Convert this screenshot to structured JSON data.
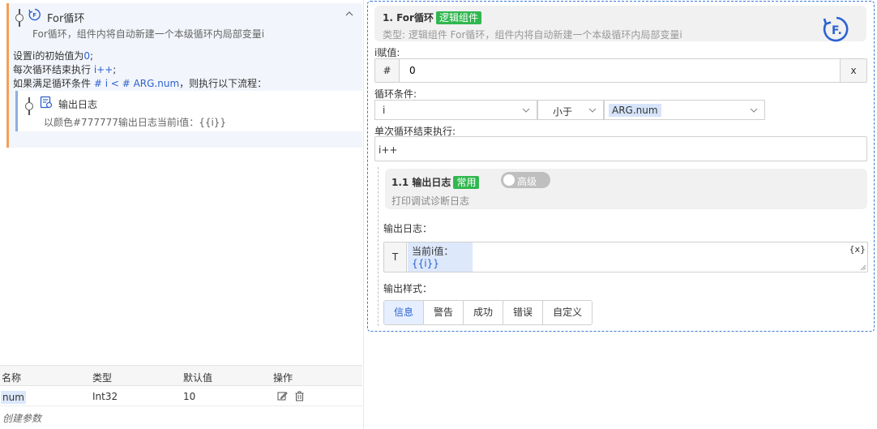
{
  "left": {
    "for_block": {
      "title": "For循环",
      "description": "For循环，组件内将自动新建一个本级循环内局部变量i",
      "body": {
        "line1_prefix": "设置i的初始值为",
        "line1_value": "0",
        "line1_suffix": ";",
        "line2_prefix": "每次循环结束执行 ",
        "line2_value": "i++",
        "line2_suffix": ";",
        "line3_prefix": "如果满足循环条件 ",
        "line3_value": "# i < # ARG.num",
        "line3_suffix": "，则执行以下流程："
      },
      "child": {
        "title": "输出日志",
        "description": "以颜色#777777输出日志当前i值：{{i}}"
      }
    },
    "params_table": {
      "headers": [
        "名称",
        "类型",
        "默认值",
        "操作"
      ],
      "rows": [
        {
          "name": "num",
          "type": "Int32",
          "default": "10"
        }
      ],
      "create_label": "创建参数"
    }
  },
  "right": {
    "header": {
      "title": "1. For循环",
      "tag": "逻辑组件",
      "subtitle": "类型:  逻辑组件 For循环，组件内将自动新建一个本级循环内局部变量i"
    },
    "init": {
      "label": "i赋值:",
      "prefix": "#",
      "value": "0",
      "clear": "x"
    },
    "condition": {
      "label": "循环条件:",
      "left": "i",
      "operator": "小于",
      "right": "ARG.num"
    },
    "step": {
      "label": "单次循环结束执行:",
      "value": "i++"
    },
    "sub": {
      "title": "1.1 输出日志",
      "tag": "常用",
      "toggle_label": "高级",
      "subtitle": "打印调试诊断日志",
      "log_label": "输出日志：",
      "log_prefix": "T",
      "log_text": "当前i值：",
      "log_var": "{{i}}",
      "log_x": "{x}",
      "style_label": "输出样式：",
      "styles": [
        "信息",
        "警告",
        "成功",
        "错误",
        "自定义"
      ]
    }
  },
  "colors": {
    "accent_blue": "#2b61d1",
    "tag_green": "#31b74f",
    "for_border": "#f0a15a"
  }
}
